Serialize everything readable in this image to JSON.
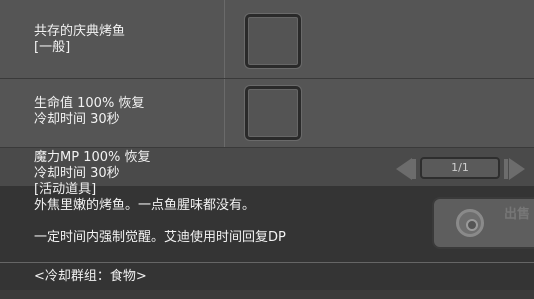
{
  "rows": [
    {
      "lines": [
        "共存的庆典烤鱼",
        "[一般]"
      ]
    },
    {
      "lines": [
        "生命值 100% 恢复",
        "冷却时间 30秒"
      ]
    }
  ],
  "detail": {
    "lines": [
      "魔力MP 100% 恢复",
      "冷却时间 30秒",
      "[活动道具]",
      "外焦里嫩的烤鱼。一点鱼腥味都没有。",
      "",
      "一定时间内强制觉醒。艾迪使用时间回复DP"
    ],
    "cooldown_group": "<冷却群组：食物>"
  },
  "pager": {
    "label": "1/1"
  },
  "button": {
    "icon": "recycle-icon",
    "label": "出售"
  }
}
